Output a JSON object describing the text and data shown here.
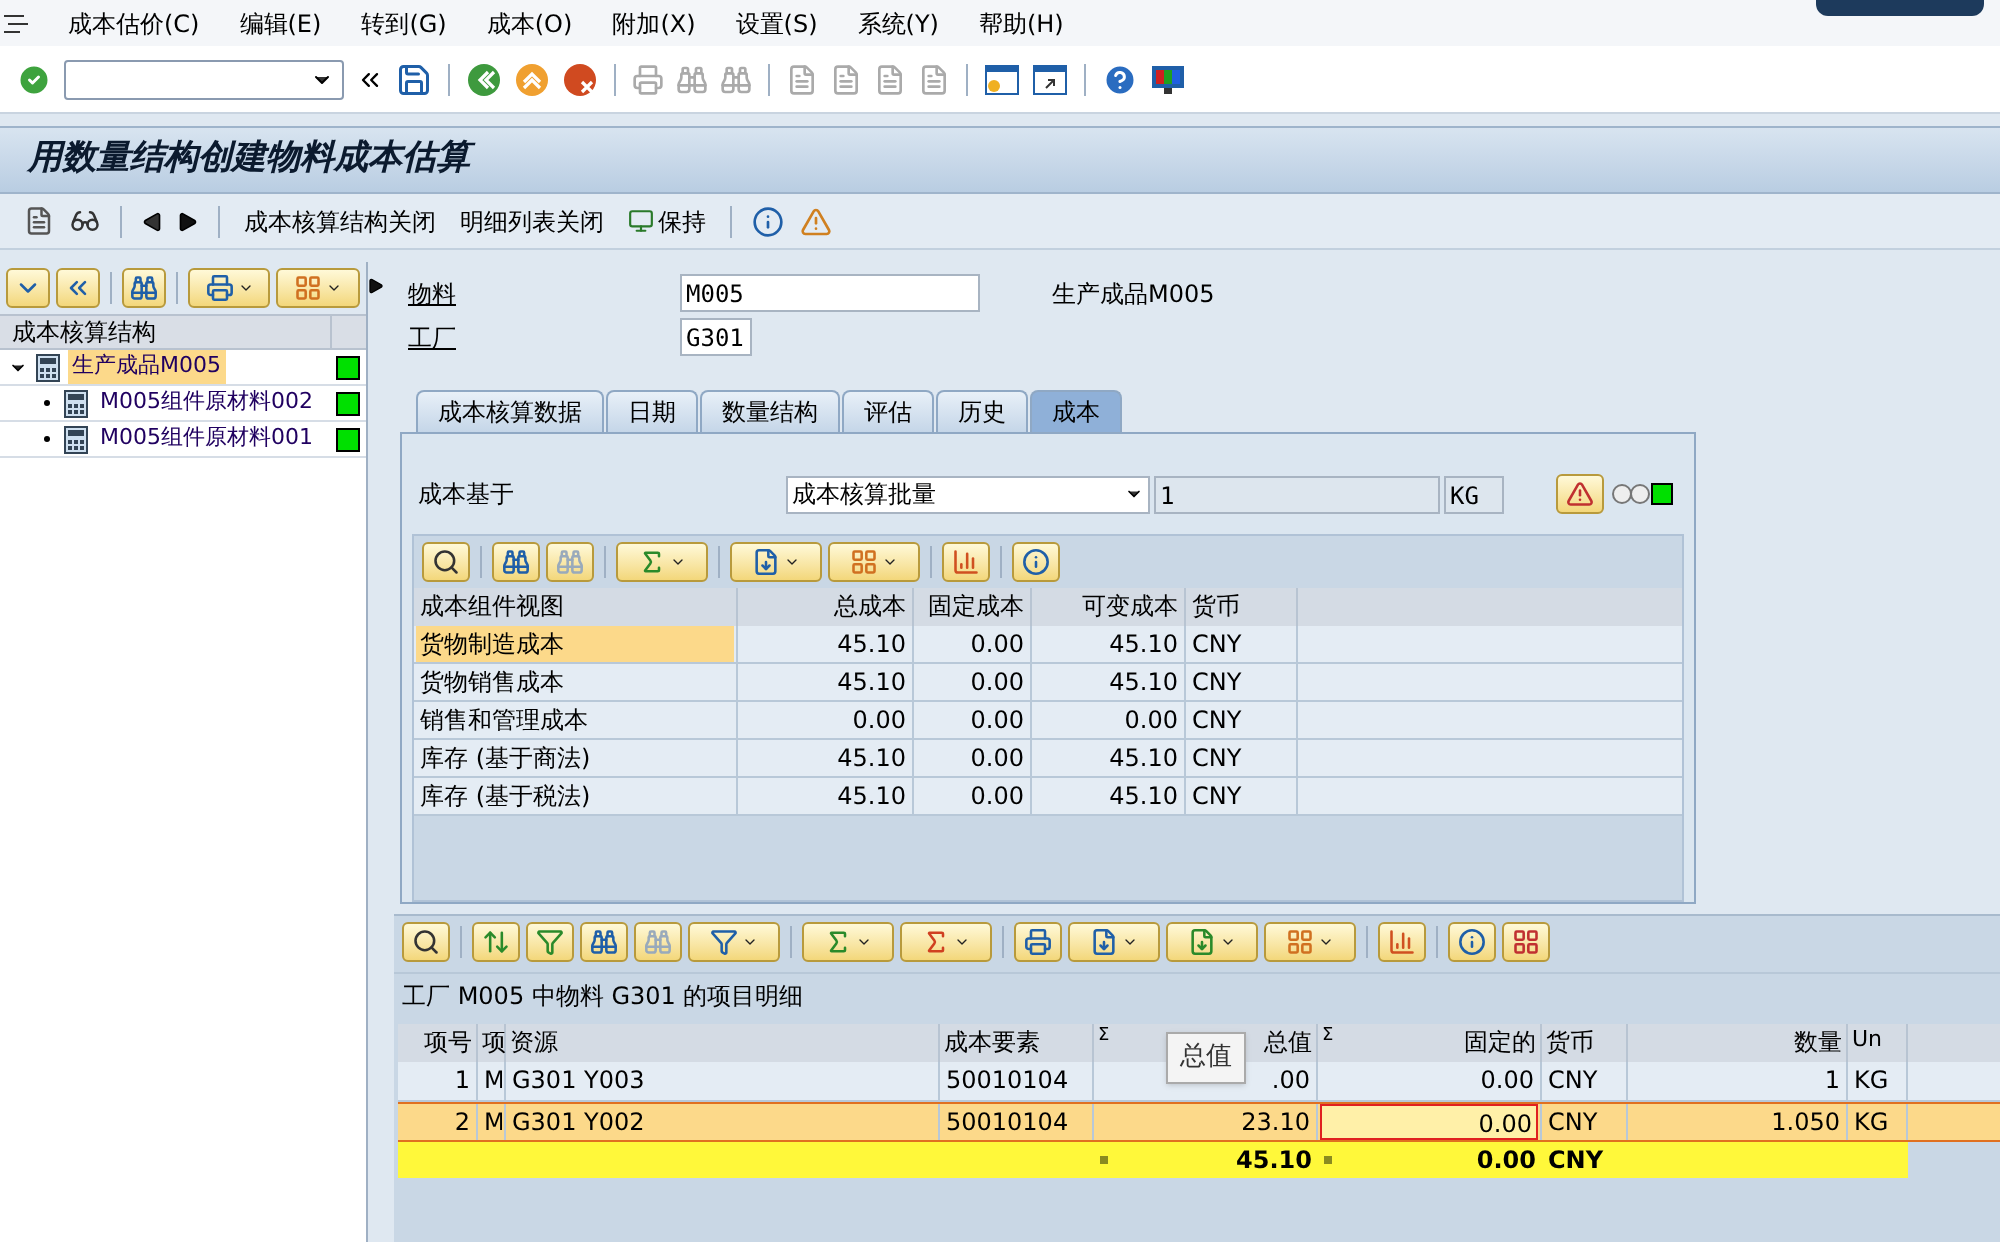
{
  "menu": [
    "成本估价(C)",
    "编辑(E)",
    "转到(G)",
    "成本(O)",
    "附加(X)",
    "设置(S)",
    "系统(Y)",
    "帮助(H)"
  ],
  "title": "用数量结构创建物料成本估算",
  "app_toolbar": [
    "成本核算结构关闭",
    "明细列表关闭",
    "保持"
  ],
  "tree": {
    "header": "成本核算结构",
    "items": [
      {
        "label": "生产成品M005",
        "selected": true,
        "expanded": true,
        "children": [
          {
            "label": "M005组件原材料002",
            "selected": false
          },
          {
            "label": "M005组件原材料001",
            "selected": false
          }
        ]
      }
    ]
  },
  "header_fields": [
    {
      "label": "物料",
      "value": "M005"
    },
    {
      "label": "工厂",
      "value": "G301"
    }
  ],
  "description": "生产成品M005",
  "tabs": [
    {
      "label": "成本核算数据",
      "selected": false
    },
    {
      "label": "日期",
      "selected": false
    },
    {
      "label": "数量结构",
      "selected": false
    },
    {
      "label": "评估",
      "selected": false
    },
    {
      "label": "历史",
      "selected": false
    },
    {
      "label": "成本",
      "selected": true
    }
  ],
  "cost_basis": {
    "label": "成本基于",
    "value": "成本核算批量",
    "quantity": "1",
    "unit": "KG"
  },
  "component_table": {
    "columns": [
      "成本组件视图",
      "总成本",
      "固定成本",
      "可变成本",
      "货币"
    ],
    "rows": [
      {
        "cells": [
          "货物制造成本",
          "45.10",
          "0.00",
          "45.10",
          "CNY"
        ],
        "selected": true
      },
      {
        "cells": [
          "货物销售成本",
          "45.10",
          "0.00",
          "45.10",
          "CNY"
        ],
        "selected": false
      },
      {
        "cells": [
          "销售和管理成本",
          "0.00",
          "0.00",
          "0.00",
          "CNY"
        ],
        "selected": false
      },
      {
        "cells": [
          "库存 (基于商法)",
          "45.10",
          "0.00",
          "45.10",
          "CNY"
        ],
        "selected": false
      },
      {
        "cells": [
          "库存 (基于税法)",
          "45.10",
          "0.00",
          "45.10",
          "CNY"
        ],
        "selected": false
      }
    ]
  },
  "detail": {
    "title": "工厂 M005 中物料 G301 的项目明细",
    "columns": [
      {
        "label": "项号"
      },
      {
        "label": "项"
      },
      {
        "label": "资源"
      },
      {
        "label": "成本要素"
      },
      {
        "label": "总值",
        "sum": "Σ"
      },
      {
        "label": "固定的",
        "sum": "Σ"
      },
      {
        "label": "货币"
      },
      {
        "label": "数量"
      },
      {
        "label": "Un"
      }
    ],
    "rows": [
      {
        "cells": [
          "1",
          "M",
          "G301 Y003",
          "50010104",
          ".00",
          "0.00",
          "CNY",
          "1",
          "KG"
        ],
        "selected": false,
        "focused": false
      },
      {
        "cells": [
          "2",
          "M",
          "G301 Y002",
          "50010104",
          "23.10",
          "0.00",
          "CNY",
          "1.050",
          "KG"
        ],
        "selected": true,
        "focused": true
      }
    ],
    "totals": {
      "total_value": "45.10",
      "fixed": "0.00",
      "currency": "CNY"
    },
    "tooltip": "总值"
  }
}
